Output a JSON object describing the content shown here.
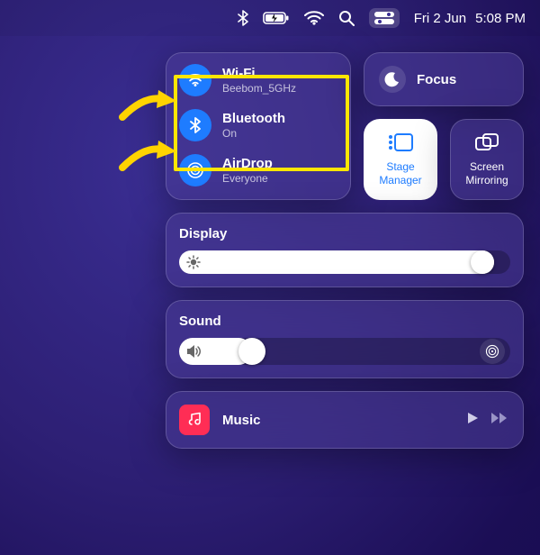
{
  "menubar": {
    "date": "Fri 2 Jun",
    "time": "5:08 PM"
  },
  "cc": {
    "wifi": {
      "title": "Wi-Fi",
      "sub": "Beebom_5GHz"
    },
    "bluetooth": {
      "title": "Bluetooth",
      "sub": "On"
    },
    "airdrop": {
      "title": "AirDrop",
      "sub": "Everyone"
    },
    "focus": {
      "label": "Focus"
    },
    "stage": {
      "label_l1": "Stage",
      "label_l2": "Manager"
    },
    "mirror": {
      "label_l1": "Screen",
      "label_l2": "Mirroring"
    },
    "display": {
      "title": "Display",
      "value_pct": 95
    },
    "sound": {
      "title": "Sound",
      "value_pct": 22
    },
    "music": {
      "label": "Music"
    }
  }
}
